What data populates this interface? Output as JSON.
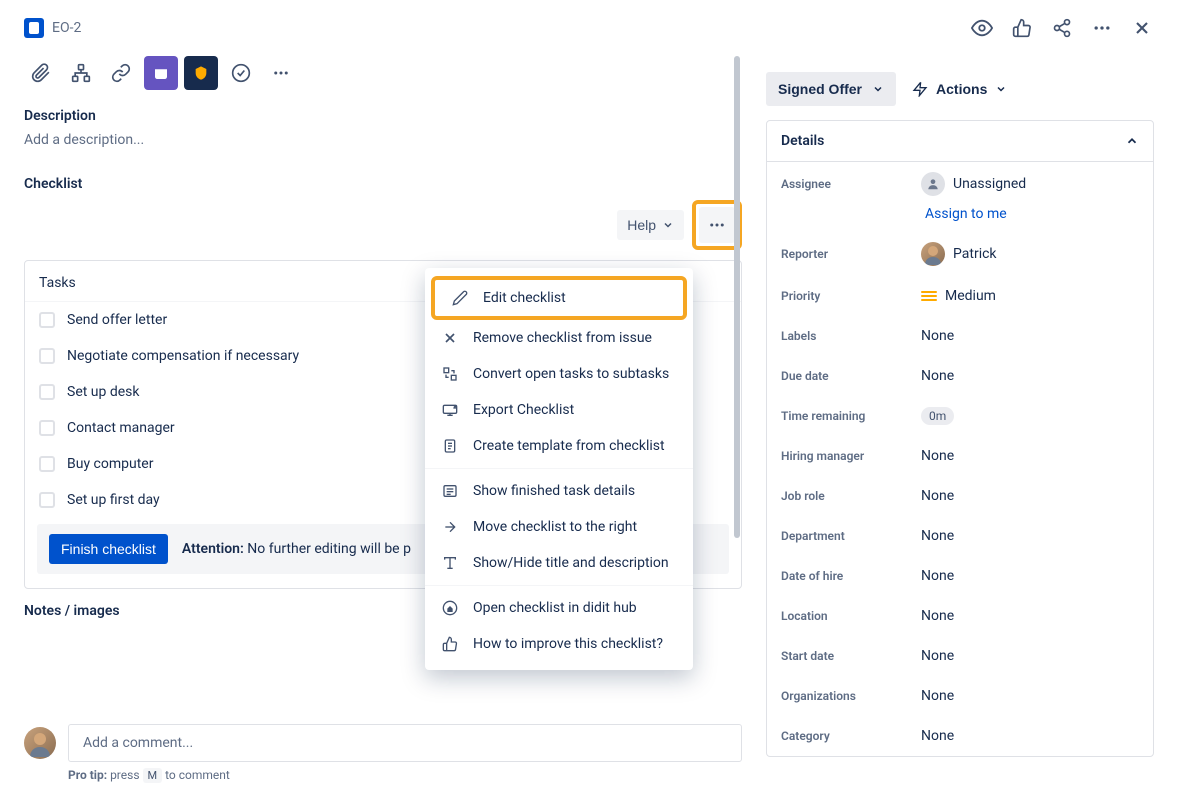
{
  "header": {
    "issue_key": "EO-2"
  },
  "description": {
    "label": "Description",
    "placeholder": "Add a description..."
  },
  "checklist": {
    "label": "Checklist",
    "help_label": "Help",
    "tasks_header": "Tasks",
    "tasks": [
      "Send offer letter",
      "Negotiate compensation if necessary",
      "Set up desk",
      "Contact manager",
      "Buy computer",
      "Set up first day"
    ],
    "finish_button": "Finish checklist",
    "attention_label": "Attention:",
    "attention_text": "No further editing will be p",
    "notes_label": "Notes / images"
  },
  "menu": {
    "edit": "Edit checklist",
    "remove": "Remove checklist from issue",
    "convert": "Convert open tasks to subtasks",
    "export": "Export Checklist",
    "template": "Create template from checklist",
    "show_finished": "Show finished task details",
    "move_right": "Move checklist to the right",
    "show_hide": "Show/Hide title and description",
    "open_hub": "Open checklist in didit hub",
    "improve": "How to improve this checklist?"
  },
  "comment": {
    "placeholder": "Add a comment...",
    "pro_tip_label": "Pro tip:",
    "pro_tip_before": "press",
    "pro_tip_key": "M",
    "pro_tip_after": "to comment"
  },
  "side": {
    "status": "Signed Offer",
    "actions": "Actions",
    "details_label": "Details",
    "assignee_label": "Assignee",
    "assignee_value": "Unassigned",
    "assign_to_me": "Assign to me",
    "reporter_label": "Reporter",
    "reporter_value": "Patrick",
    "priority_label": "Priority",
    "priority_value": "Medium",
    "labels_label": "Labels",
    "labels_value": "None",
    "due_label": "Due date",
    "due_value": "None",
    "time_label": "Time remaining",
    "time_value": "0m",
    "hiring_label": "Hiring manager",
    "hiring_value": "None",
    "jobrole_label": "Job role",
    "jobrole_value": "None",
    "dept_label": "Department",
    "dept_value": "None",
    "hiredate_label": "Date of hire",
    "hiredate_value": "None",
    "location_label": "Location",
    "location_value": "None",
    "startdate_label": "Start date",
    "startdate_value": "None",
    "orgs_label": "Organizations",
    "orgs_value": "None",
    "category_label": "Category",
    "category_value": "None"
  }
}
